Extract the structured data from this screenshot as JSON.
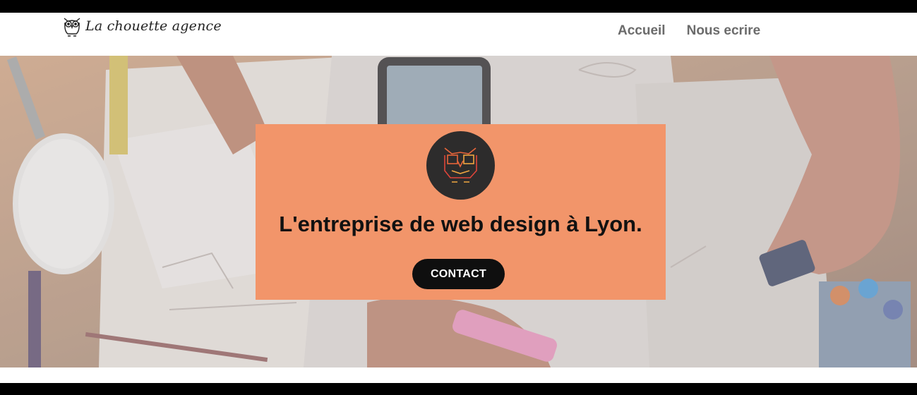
{
  "brand": {
    "name": "La chouette agence",
    "logo_icon": "owl-icon"
  },
  "nav": {
    "items": [
      {
        "label": "Accueil"
      },
      {
        "label": "Nous ecrire"
      }
    ]
  },
  "hero": {
    "background": "desk-workspace-photo",
    "card": {
      "badge_icon": "owl-icon",
      "title": "L'entreprise de web design à Lyon.",
      "cta_label": "CONTACT"
    }
  },
  "colors": {
    "accent": "#f2956a",
    "dark": "#0f0f0f",
    "badge": "#2d2c2c",
    "nav_text": "#6b6b6b"
  }
}
